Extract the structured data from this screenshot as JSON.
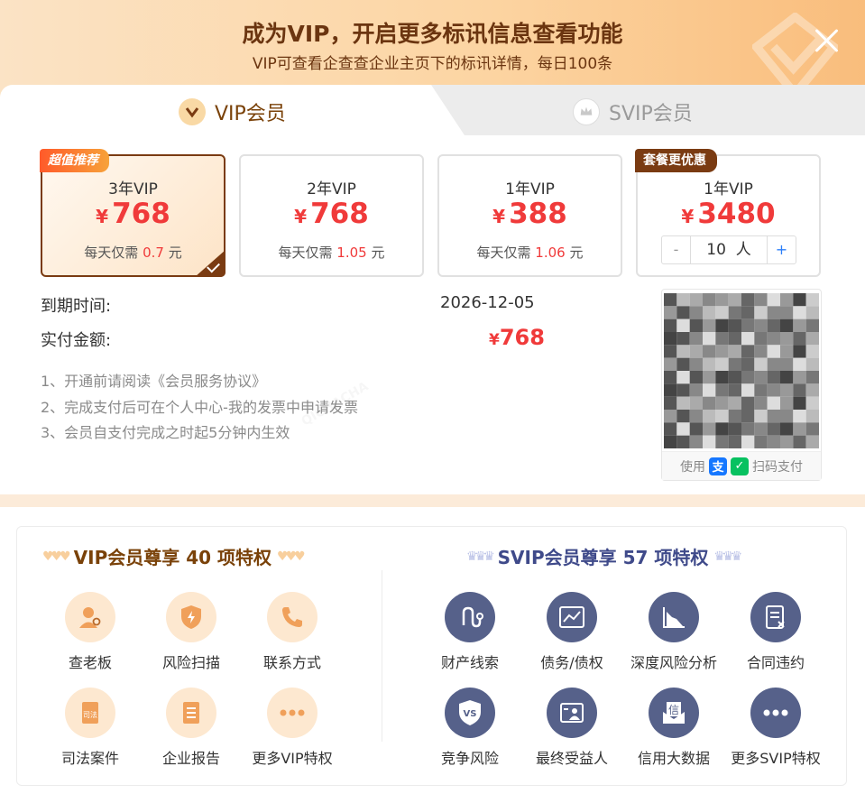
{
  "header": {
    "title": "成为VIP，开启更多标讯信息查看功能",
    "subtitle": "VIP可查看企查查企业主页下的标讯详情，每日100条"
  },
  "tabs": [
    {
      "label": "VIP会员",
      "active": true
    },
    {
      "label": "SVIP会员",
      "active": false
    }
  ],
  "plans": [
    {
      "badge": "超值推荐",
      "name": "3年VIP",
      "currency": "¥",
      "price": "768",
      "daily_prefix": "每天仅需 ",
      "daily_value": "0.7",
      "daily_suffix": " 元",
      "selected": true
    },
    {
      "name": "2年VIP",
      "currency": "¥",
      "price": "768",
      "daily_prefix": "每天仅需 ",
      "daily_value": "1.05",
      "daily_suffix": " 元",
      "selected": false
    },
    {
      "name": "1年VIP",
      "currency": "¥",
      "price": "388",
      "daily_prefix": "每天仅需 ",
      "daily_value": "1.06",
      "daily_suffix": " 元",
      "selected": false
    },
    {
      "badge": "套餐更优惠",
      "name": "1年VIP",
      "currency": "¥",
      "price": "3480",
      "stepper": {
        "minus": "-",
        "value": "10",
        "unit": "人",
        "plus": "+"
      },
      "selected": false
    }
  ],
  "order": {
    "expiry_label": "到期时间:",
    "expiry_value": "2026-12-05",
    "paid_label": "实付金额:",
    "paid_currency": "¥",
    "paid_value": "768"
  },
  "notes": [
    "1、开通前请阅读《会员服务协议》",
    "2、完成支付后可在个人中心-我的发票中申请发票",
    "3、会员自支付完成之时起5分钟内生效"
  ],
  "qr": {
    "prefix": "使用",
    "suffix": "扫码支付",
    "alipay_glyph": "支",
    "wechat_glyph": "✓"
  },
  "vip_privileges": {
    "title": "VIP会员尊享 40 项特权",
    "items": [
      {
        "label": "查老板",
        "icon": "boss-icon"
      },
      {
        "label": "风险扫描",
        "icon": "shield-scan-icon"
      },
      {
        "label": "联系方式",
        "icon": "phone-icon"
      },
      {
        "label": "司法案件",
        "icon": "law-case-icon"
      },
      {
        "label": "企业报告",
        "icon": "report-icon"
      },
      {
        "label": "更多VIP特权",
        "icon": "more-icon"
      }
    ]
  },
  "svip_privileges": {
    "title": "SVIP会员尊享 57 项特权",
    "items": [
      {
        "label": "财产线索",
        "icon": "asset-clue-icon"
      },
      {
        "label": "债务/债权",
        "icon": "debt-chart-icon"
      },
      {
        "label": "深度风险分析",
        "icon": "risk-analysis-icon"
      },
      {
        "label": "合同违约",
        "icon": "contract-breach-icon"
      },
      {
        "label": "竞争风险",
        "icon": "vs-icon"
      },
      {
        "label": "最终受益人",
        "icon": "beneficiary-icon"
      },
      {
        "label": "信用大数据",
        "icon": "credit-data-icon",
        "glyph": "信"
      },
      {
        "label": "更多SVIP特权",
        "icon": "more-icon"
      }
    ]
  },
  "colors": {
    "accent_brown": "#7a3b12",
    "price_red": "#f03a3a",
    "svip_navy": "#56618a",
    "vip_icon_bg": "#fde8d0"
  }
}
